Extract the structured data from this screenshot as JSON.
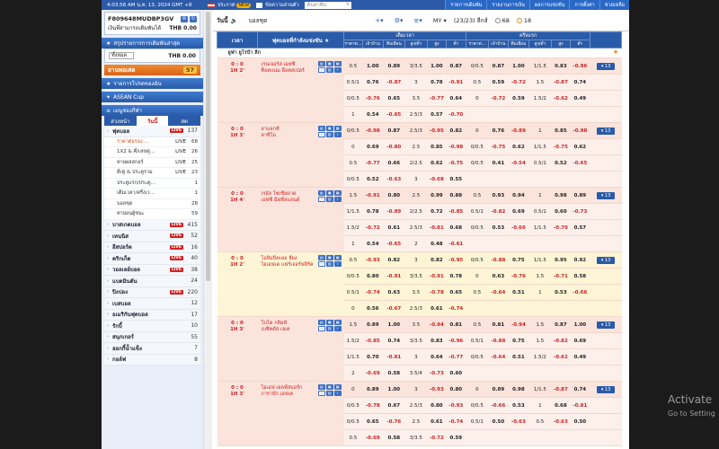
{
  "topbar": {
    "clock": "4:03:56 AM น.ค. 13, 2024 GMT +8",
    "announce_label": "ประกาศ",
    "announce_badge": "NEW",
    "messages_label": "ข้อความส่วนตัว",
    "search_placeholder": "ค้นหาทีม",
    "nav": [
      "รายการเดิมพัน",
      "รายงานการเงิน",
      "ผลการแข่งขัน",
      "การตั้งค่า",
      "ช่วยเหลือ"
    ]
  },
  "account": {
    "id": "F809648MUDBP3GV",
    "credit_label": "เงินที่สามารถเดิมพันได้",
    "credit_value": "THB 0.00",
    "summary_title": "สรุปรายการการเดิมพันล่าสุด",
    "balance_select": "ทั้งหมด",
    "balance_value": "THB 0.00",
    "pending_label": "ยานพอเสด",
    "pending_count": "57",
    "favourites_label": "รายการโปรดของฉัน",
    "asean_label": "ASEAN Cup",
    "menu_label": "เมนูช่องกีฬา",
    "tabs": [
      "ล่วงหน้า",
      "วันนี้",
      "สด"
    ]
  },
  "sports": [
    {
      "name": "ฟุตบอล",
      "live": true,
      "count": "137",
      "sub": [
        {
          "name": "ราคาต่อรอง ...",
          "live": true,
          "count": "68",
          "selected": true
        },
        {
          "name": "1X2 & คี่/เลขคู่...",
          "live": true,
          "count": "26"
        },
        {
          "name": "ทายผลสกอร์",
          "live": true,
          "count": "25"
        },
        {
          "name": "คี่/คู่ & ประตูรวม",
          "live": true,
          "count": "23"
        },
        {
          "name": "ประตูแรก/ประตู...",
          "live": false,
          "count": "1"
        },
        {
          "name": "เต็มเวลา/ครึ่งเว...",
          "live": false,
          "count": "1"
        },
        {
          "name": "บอลชุด",
          "live": false,
          "count": "28"
        },
        {
          "name": "ทายอนผู้ชนะ",
          "live": false,
          "count": "59"
        }
      ]
    },
    {
      "name": "บาสเกตบอล",
      "live": true,
      "count": "415"
    },
    {
      "name": "เทนนิส",
      "live": true,
      "count": "52"
    },
    {
      "name": "อีสปอร์ต",
      "live": true,
      "count": "16"
    },
    {
      "name": "คริกเก็ต",
      "live": true,
      "count": "40"
    },
    {
      "name": "วอลเลย์บอล",
      "live": true,
      "count": "38"
    },
    {
      "name": "แบดมินตัน",
      "live": false,
      "count": "24"
    },
    {
      "name": "ปิงปอง",
      "live": true,
      "count": "220"
    },
    {
      "name": "เบสบอล",
      "live": false,
      "count": "12"
    },
    {
      "name": "อเมริกันฟุตบอล",
      "live": false,
      "count": "17"
    },
    {
      "name": "รักบี้",
      "live": false,
      "count": "10"
    },
    {
      "name": "สนุกเกอร์",
      "live": false,
      "count": "55"
    },
    {
      "name": "ฮอกกี้น้ำแข็ง",
      "live": false,
      "count": "7"
    },
    {
      "name": "กอล์ฟ",
      "live": false,
      "count": "8"
    }
  ],
  "toolbar": {
    "today": "วันนี้",
    "mode": "บอลชุด",
    "odds_type": "MY",
    "leagues": "(23/23) ลีกส์",
    "count_a": "68",
    "count_b": "18"
  },
  "table": {
    "h_time": "เวลา",
    "h_match": "ฟุตบอลที่กำลังแข่งขัน",
    "h_full": "เต็มเวลา",
    "h_half": "ครึ่งแรก",
    "sub": [
      "ราคาต่...",
      "เจ้าบ้าน",
      "ทีมเยือน",
      "สูง/ต่ำ",
      "สูง",
      "ต่ำ",
      "ราคาต่...",
      "เจ้าบ้าน",
      "ทีมเยือน",
      "สูง/ต่ำ",
      "สูง",
      "ต่ำ"
    ],
    "league": "ยูฟ่า ยูโรป้า ลีก",
    "matches": [
      {
        "score": "0 : 0",
        "period": "1H 2'",
        "home": "เรนเจอร์ส เอฟซี",
        "away": "ท็อตแนม ฮ็อตสเปอร์",
        "highlight": false,
        "rows": [
          [
            "0.5",
            "1.00",
            "0.89",
            "3/3.5",
            "1.00",
            "0.87",
            "0/0.5",
            "0.87",
            "1.00",
            "1/1.5",
            "0.83",
            "-0.96"
          ],
          [
            "0.5/1",
            "0.76",
            "-0.87",
            "3",
            "0.78",
            "-0.91",
            "0.5",
            "0.59",
            "-0.72",
            "1.5",
            "-0.87",
            "0.74"
          ],
          [
            "0/0.5",
            "-0.76",
            "0.65",
            "3.5",
            "-0.77",
            "0.64",
            "0",
            "-0.72",
            "0.59",
            "1.5/2",
            "-0.62",
            "0.49"
          ],
          [
            "1",
            "0.54",
            "-0.65",
            "2.5/3",
            "0.57",
            "-0.70",
            "",
            "",
            "",
            "",
            "",
            ""
          ]
        ]
      },
      {
        "score": "0 : 0",
        "period": "1H 3'",
        "home": "อาแจกซ์",
        "away": "ลาซิโอ",
        "highlight": false,
        "rows": [
          [
            "0/0.5",
            "-0.98",
            "0.87",
            "2.5/3",
            "-0.95",
            "0.82",
            "0",
            "0.76",
            "-0.89",
            "1",
            "0.85",
            "-0.98"
          ],
          [
            "0",
            "0.69",
            "-0.80",
            "2.5",
            "0.85",
            "-0.98",
            "0/0.5",
            "-0.75",
            "0.62",
            "1/1.5",
            "-0.75",
            "0.62"
          ],
          [
            "0.5",
            "-0.77",
            "0.66",
            "2/2.5",
            "0.62",
            "-0.75",
            "0/0.5",
            "0.41",
            "-0.54",
            "0.5/1",
            "0.52",
            "-0.65"
          ],
          [
            "0/0.5",
            "0.52",
            "-0.63",
            "3",
            "-0.68",
            "0.55",
            "",
            "",
            "",
            "",
            "",
            ""
          ]
        ]
      },
      {
        "score": "0 : 0",
        "period": "1H 4'",
        "home": "เรอัล โซเซียดาด",
        "away": "เอฟซี มิดทีลแลนด์",
        "highlight": false,
        "rows": [
          [
            "1.5",
            "-0.91",
            "0.80",
            "2.5",
            "0.99",
            "0.88",
            "0.5",
            "0.93",
            "0.94",
            "1",
            "0.98",
            "0.89"
          ],
          [
            "1/1.5",
            "0.78",
            "-0.89",
            "2/2.5",
            "0.72",
            "-0.85",
            "0.5/1",
            "-0.82",
            "0.69",
            "0.5/1",
            "0.60",
            "-0.73"
          ],
          [
            "1.5/2",
            "-0.72",
            "0.61",
            "2.5/3",
            "-0.81",
            "0.68",
            "0/0.5",
            "0.53",
            "-0.66",
            "1/1.5",
            "-0.70",
            "0.57"
          ],
          [
            "1",
            "0.54",
            "-0.65",
            "2",
            "0.48",
            "-0.61",
            "",
            "",
            "",
            "",
            "",
            ""
          ]
        ]
      },
      {
        "score": "0 : 0",
        "period": "1H 2'",
        "home": "โอลิมปิคเลอ ลียง",
        "away": "ไอเอฟเค แฟร์เจอร์ฟลิร์ค",
        "highlight": true,
        "rows": [
          [
            "0.5",
            "-0.93",
            "0.82",
            "3",
            "0.82",
            "-0.95",
            "0/0.5",
            "-0.88",
            "0.75",
            "1/1.5",
            "0.95",
            "0.92"
          ],
          [
            "0/0.5",
            "0.80",
            "-0.91",
            "3/3.5",
            "-0.91",
            "0.78",
            "0",
            "0.63",
            "-0.76",
            "1.5",
            "-0.71",
            "0.58"
          ],
          [
            "0.5/1",
            "-0.74",
            "0.63",
            "3.5",
            "-0.78",
            "0.65",
            "0.5",
            "-0.64",
            "0.51",
            "1",
            "0.53",
            "-0.66"
          ],
          [
            "0",
            "0.56",
            "-0.67",
            "2.5/3",
            "0.61",
            "-0.74",
            "",
            "",
            "",
            "",
            "",
            ""
          ]
        ]
      },
      {
        "score": "0 : 0",
        "period": "1H 3'",
        "home": "โบโด กลิมท์",
        "away": "เบซิคตัส เจเค",
        "highlight": false,
        "rows": [
          [
            "1.5",
            "0.89",
            "1.00",
            "3.5",
            "-0.94",
            "0.81",
            "0.5",
            "0.81",
            "-0.94",
            "1.5",
            "0.87",
            "1.00"
          ],
          [
            "1.5/2",
            "-0.85",
            "0.74",
            "3/3.5",
            "0.83",
            "-0.96",
            "0.5/1",
            "-0.88",
            "0.75",
            "1.5",
            "-0.82",
            "0.69"
          ],
          [
            "1/1.5",
            "0.70",
            "-0.81",
            "3",
            "0.64",
            "-0.77",
            "0/0.5",
            "-0.64",
            "0.51",
            "1.5/2",
            "-0.62",
            "0.49"
          ],
          [
            "2",
            "-0.69",
            "0.58",
            "3.5/4",
            "-0.73",
            "0.60",
            "",
            "",
            "",
            "",
            "",
            ""
          ]
        ]
      },
      {
        "score": "0 : 0",
        "period": "1H 3'",
        "home": "ไอเอฟ เอลฟ์สบอร์ก",
        "away": "การาบัก เอฟเค",
        "highlight": false,
        "rows": [
          [
            "0",
            "0.89",
            "1.00",
            "3",
            "-0.93",
            "0.80",
            "0",
            "0.89",
            "0.98",
            "1/1.5",
            "-0.87",
            "0.74"
          ],
          [
            "0/0.5",
            "-0.78",
            "0.67",
            "2.5/3",
            "0.80",
            "-0.93",
            "0/0.5",
            "-0.66",
            "0.53",
            "1",
            "0.68",
            "-0.81"
          ],
          [
            "0/0.5",
            "0.65",
            "-0.76",
            "2.5",
            "0.61",
            "-0.74",
            "0.5/1",
            "0.50",
            "-0.63",
            "0.5",
            "-0.63",
            "0.50"
          ],
          [
            "0.5",
            "-0.69",
            "0.58",
            "3/3.5",
            "-0.72",
            "0.59",
            "",
            "",
            "",
            "",
            "",
            ""
          ]
        ]
      }
    ]
  },
  "watermark": {
    "line1": "Activate",
    "line2": "Go to Setting"
  }
}
